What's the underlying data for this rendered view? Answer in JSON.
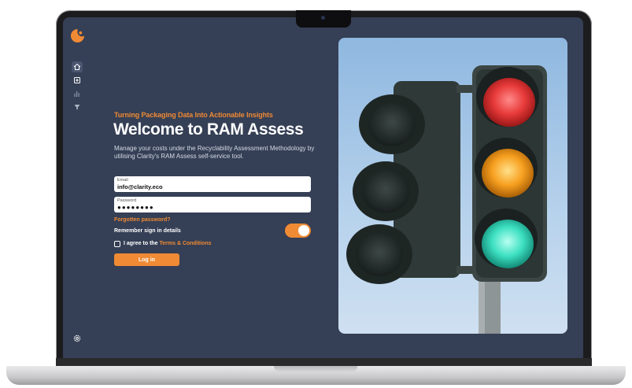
{
  "sidebar": {
    "items": [
      {
        "icon": "home-icon",
        "active": true
      },
      {
        "icon": "dashboard-icon",
        "active": false
      },
      {
        "icon": "bar-chart-icon",
        "active": false
      },
      {
        "icon": "filter-icon",
        "active": false
      }
    ],
    "bottom_icon": "settings-icon"
  },
  "login": {
    "tagline": "Turning Packaging Data Into Actionable Insights",
    "title": "Welcome to RAM Assess",
    "intro": "Manage your costs under the Recyclability Assessment Methodology by utilising Clarity's RAM Assess self-service tool.",
    "email_label": "Email",
    "email_value": "info@clarity.eco",
    "password_label": "Password",
    "password_value": "●●●●●●●●",
    "forgot_link": "Forgotten password?",
    "remember_label": "Remember sign in details",
    "remember_on": true,
    "agree_prefix": "I agree to the ",
    "agree_link": "Terms & Conditions",
    "agree_checked": false,
    "login_button": "Log in"
  },
  "colors": {
    "accent": "#f08a34",
    "background": "#353f55",
    "text": "#ffffff"
  }
}
